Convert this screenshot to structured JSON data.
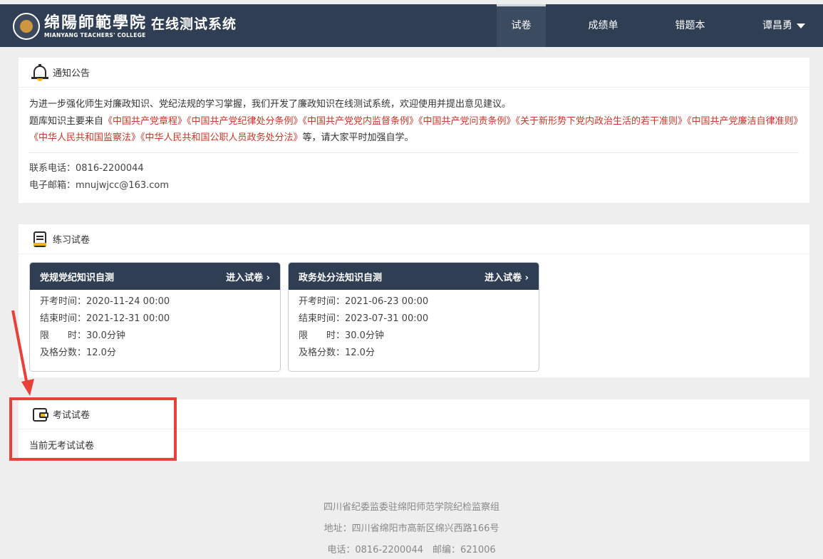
{
  "header": {
    "brand_cn": "绵陽師範學院",
    "brand_en": "MIANYANG TEACHERS' COLLEGE",
    "system_title": "在线测试系统",
    "nav": [
      {
        "label": "试卷"
      },
      {
        "label": "成绩单"
      },
      {
        "label": "错题本"
      }
    ],
    "user": "谭昌勇"
  },
  "notice": {
    "title": "通知公告",
    "intro": "为进一步强化师生对廉政知识、党纪法规的学习掌握，我们开发了廉政知识在线测试系统，欢迎使用并提出意见建议。",
    "bank_prefix": "题库知识主要来自",
    "bank_sources": "《中国共产党章程》《中国共产党纪律处分条例》《中国共产党党内监督条例》《中国共产党问责条例》《关于新形势下党内政治生活的若干准则》《中国共产党廉洁自律准则》《中华人民共和国监察法》《中华人民共和国公职人员政务处分法》",
    "bank_suffix": "等，请大家平时加强自学。",
    "phone": "联系电话：0816-2200044",
    "email": "电子邮箱：mnujwjcc@163.com"
  },
  "practice": {
    "title": "练习试卷",
    "enter_label": "进入试卷 ›",
    "cards": [
      {
        "name": "党规党纪知识自测",
        "start": "开考时间：2020-11-24 00:00",
        "end": "结束时间：2021-12-31 00:00",
        "limit": "限　　时：30.0分钟",
        "pass": "及格分数：12.0分"
      },
      {
        "name": "政务处分法知识自测",
        "start": "开考时间：2021-06-23 00:00",
        "end": "结束时间：2023-07-31 00:00",
        "limit": "限　　时：30.0分钟",
        "pass": "及格分数：12.0分"
      }
    ]
  },
  "exam": {
    "title": "考试试卷",
    "empty_text": "当前无考试试卷"
  },
  "footer": {
    "line1": "四川省纪委监委驻绵阳师范学院纪检监察组",
    "line2": "地址：四川省绵阳市高新区绵兴西路166号",
    "line3": "电话：0816-2200044　邮编：621006"
  },
  "colors": {
    "navbar": "#2f3e52",
    "accent_red": "#c0392b",
    "annotation": "#e8413a",
    "icon_yellow": "#f2b705"
  }
}
